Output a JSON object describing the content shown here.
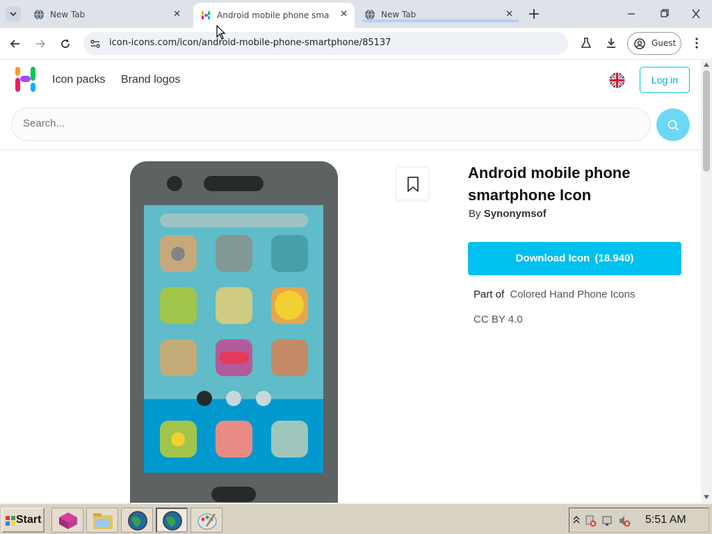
{
  "browser": {
    "tabs": [
      {
        "title": "New Tab",
        "active": false
      },
      {
        "title": "Android mobile phone smartph",
        "active": true
      },
      {
        "title": "New Tab",
        "active": false
      }
    ],
    "url": "icon-icons.com/icon/android-mobile-phone-smartphone/85137",
    "profile_label": "Guest"
  },
  "site": {
    "nav": {
      "icon_packs": "Icon packs",
      "brand_logos": "Brand logos",
      "login": "Log in"
    },
    "search": {
      "placeholder": "Search..."
    },
    "icon_title": "Android mobile phone smartphone Icon",
    "by_prefix": "By",
    "author": "Synonymsof",
    "download_label": "Download Icon",
    "download_count": "(18.940)",
    "part_of_label": "Part of",
    "pack_name": "Colored Hand Phone Icons",
    "license": "CC BY 4.0"
  },
  "taskbar": {
    "start_label": "Start",
    "clock": "5:51 AM"
  },
  "colors": {
    "accent": "#00c0f0",
    "phone_body": "#5d6263",
    "phone_screen": "#5fbcc8",
    "dock": "#0299cf"
  }
}
